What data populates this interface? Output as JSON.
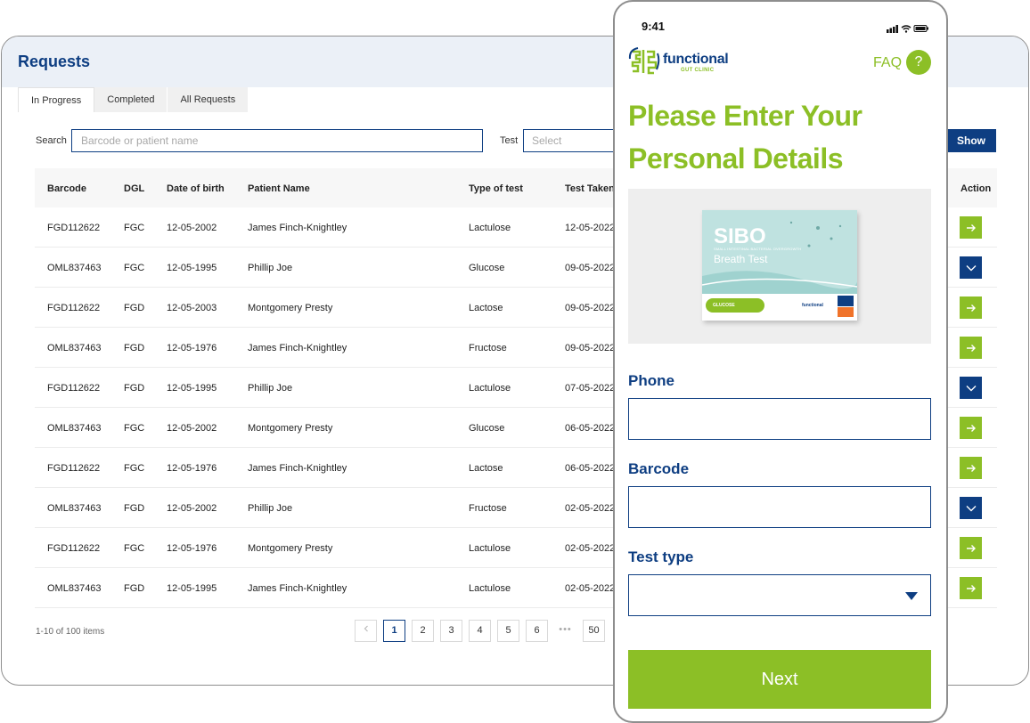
{
  "desktop": {
    "title": "Requests",
    "tabs": [
      "In Progress",
      "Completed",
      "All Requests"
    ],
    "search_label": "Search",
    "search_placeholder": "Barcode or patient name",
    "test_label": "Test",
    "test_placeholder": "Select",
    "show_label": "Show",
    "columns": [
      "Barcode",
      "DGL",
      "Date of birth",
      "Patient Name",
      "Type of test",
      "Test Taken",
      "Action"
    ],
    "rows": [
      {
        "barcode": "FGD112622",
        "dgl": "FGC",
        "dob": "12-05-2002",
        "name": "James Finch-Knightley",
        "test": "Lactulose",
        "taken": "12-05-2022",
        "action": "arrow-right"
      },
      {
        "barcode": "OML837463",
        "dgl": "FGC",
        "dob": "12-05-1995",
        "name": "Phillip Joe",
        "test": "Glucose",
        "taken": "09-05-2022",
        "action": "chevron-down"
      },
      {
        "barcode": "FGD112622",
        "dgl": "FGD",
        "dob": "12-05-2003",
        "name": "Montgomery Presty",
        "test": "Lactose",
        "taken": "09-05-2022",
        "action": "arrow-right"
      },
      {
        "barcode": "OML837463",
        "dgl": "FGD",
        "dob": "12-05-1976",
        "name": "James Finch-Knightley",
        "test": "Fructose",
        "taken": "09-05-2022",
        "action": "arrow-right"
      },
      {
        "barcode": "FGD112622",
        "dgl": "FGD",
        "dob": "12-05-1995",
        "name": "Phillip Joe",
        "test": "Lactulose",
        "taken": "07-05-2022",
        "action": "chevron-down"
      },
      {
        "barcode": "OML837463",
        "dgl": "FGC",
        "dob": "12-05-2002",
        "name": "Montgomery Presty",
        "test": "Glucose",
        "taken": "06-05-2022",
        "action": "arrow-right"
      },
      {
        "barcode": "FGD112622",
        "dgl": "FGC",
        "dob": "12-05-1976",
        "name": "James Finch-Knightley",
        "test": "Lactose",
        "taken": "06-05-2022",
        "action": "arrow-right"
      },
      {
        "barcode": "OML837463",
        "dgl": "FGD",
        "dob": "12-05-2002",
        "name": "Phillip Joe",
        "test": "Fructose",
        "taken": "02-05-2022",
        "action": "chevron-down"
      },
      {
        "barcode": "FGD112622",
        "dgl": "FGC",
        "dob": "12-05-1976",
        "name": "Montgomery Presty",
        "test": "Lactulose",
        "taken": "02-05-2022",
        "action": "arrow-right"
      },
      {
        "barcode": "OML837463",
        "dgl": "FGD",
        "dob": "12-05-1995",
        "name": "James Finch-Knightley",
        "test": "Lactulose",
        "taken": "02-05-2022",
        "action": "arrow-right"
      }
    ],
    "pagination": {
      "info": "1-10 of 100 items",
      "pages": [
        "1",
        "2",
        "3",
        "4",
        "5",
        "6",
        "•••",
        "50"
      ],
      "current": "1"
    },
    "colors": {
      "primary": "#0e3e82",
      "accent": "#8cbf26",
      "header_bg": "#ebf0f7"
    }
  },
  "phone": {
    "time": "9:41",
    "brand": "functional",
    "brand_sub": "GUT CLINIC",
    "faq_label": "FAQ",
    "faq_icon": "?",
    "heading": "Please Enter Your Personal Details",
    "product": {
      "name": "SIBO",
      "subtitle": "SMALL INTESTINAL BACTERIAL OVERGROWTH",
      "product_line": "Breath Test",
      "variant": "GLUCOSE",
      "brand": "functional"
    },
    "fields": [
      {
        "label": "Phone",
        "value": ""
      },
      {
        "label": "Barcode",
        "value": ""
      },
      {
        "label": "Test type",
        "value": ""
      }
    ],
    "next_label": "Next"
  }
}
